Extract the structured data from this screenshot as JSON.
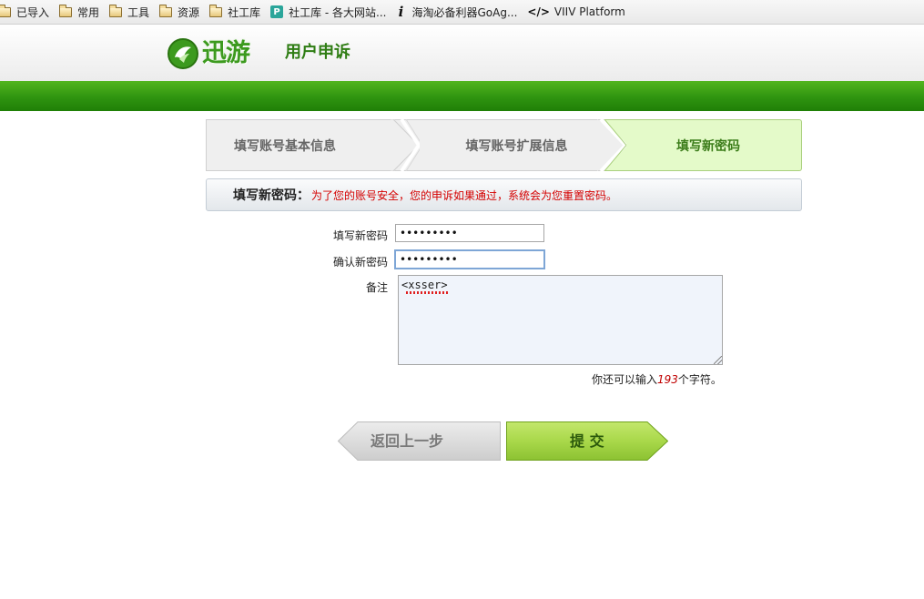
{
  "bookmarks": [
    {
      "icon": "folder-icon",
      "label": "已导入"
    },
    {
      "icon": "folder-icon",
      "label": "常用"
    },
    {
      "icon": "folder-icon",
      "label": "工具"
    },
    {
      "icon": "folder-icon",
      "label": "资源"
    },
    {
      "icon": "folder-icon",
      "label": "社工库"
    },
    {
      "icon": "site-p-icon",
      "label": "社工库 - 各大网站..."
    },
    {
      "icon": "info-i-icon",
      "label": "海淘必备利器GoAg..."
    },
    {
      "icon": "code-icon",
      "label": "VIIV Platform"
    }
  ],
  "header": {
    "logo_text": "迅游",
    "title": "用户申诉",
    "brand_color": "#3c9a1e"
  },
  "steps": {
    "step1": "填写账号基本信息",
    "step2": "填写账号扩展信息",
    "step3": "填写新密码",
    "active": 3
  },
  "notice": {
    "label": "填写新密码：",
    "text": "为了您的账号安全，您的申诉如果通过，系统会为您重置密码。"
  },
  "form": {
    "new_password_label": "填写新密码",
    "new_password_value": "•••••••••",
    "confirm_password_label": "确认新密码",
    "confirm_password_value": "•••••••••",
    "remark_label": "备注",
    "remark_value": "<xsser>",
    "counter_prefix": "你还可以输入",
    "counter_num": "193",
    "counter_suffix": "个字符。"
  },
  "buttons": {
    "back": "返回上一步",
    "submit": "提 交"
  },
  "colors": {
    "green_bar": "#2f9410",
    "active_step_bg": "#e4fac9",
    "notice_text": "#d40000",
    "submit_bg": "#a9d84a"
  }
}
